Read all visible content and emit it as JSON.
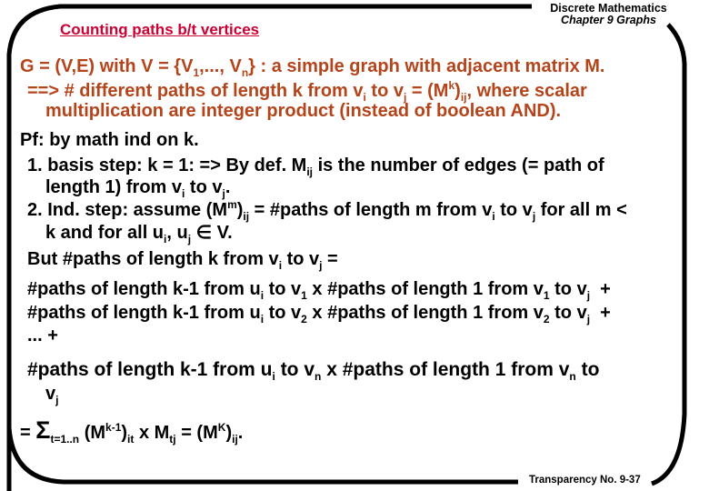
{
  "header": {
    "title": "Counting paths b/t vertices",
    "course": "Discrete Mathematics",
    "chapter": "Chapter 9 Graphs"
  },
  "colors": {
    "title": "#cc0033",
    "statement": "#b5441a",
    "body": "#000000",
    "frame": "#000000"
  },
  "body": {
    "l1": {
      "a": "G = (V,E) with V = {V",
      "s1": "1",
      "b": ",..., V",
      "s2": "n",
      "c": "} : a simple graph with adjacent matrix M."
    },
    "l2": {
      "a": "==> # different paths of length k from v",
      "s1": "i",
      "b": " to v",
      "s2": "j",
      "c": " = (M",
      "p1": "k",
      "d": ")",
      "s3": "ij",
      "e": ", where scalar"
    },
    "l3": "multiplication are integer product (instead of boolean AND).",
    "l4": "Pf: by math ind on k.",
    "l5": {
      "a": "1. basis step: k = 1: => By def. M",
      "s1": "ij",
      "b": " is the number of edges (= path of"
    },
    "l6": {
      "a": "length 1) from v",
      "s1": "i",
      "b": " to v",
      "s2": "j",
      "c": "."
    },
    "l7": {
      "a": "2. Ind. step: assume (M",
      "p1": "m",
      "b": ")",
      "s1": "ij",
      "c": " = #paths of length m from v",
      "s2": "i",
      "d": " to v",
      "s3": "j",
      "e": " for all m <"
    },
    "l8": {
      "a": "k and for all u",
      "s1": "i",
      "b": ", u",
      "s2": "j",
      "c": " ∈ V."
    },
    "l9": {
      "a": "But #paths of length k from v",
      "s1": "i",
      "b": " to v",
      "s2": "j",
      "c": " ="
    },
    "l10": {
      "a": "#paths of length k-1 from u",
      "s1": "i",
      "b": " to v",
      "s2": "1",
      "c": " x #paths of length 1 from v",
      "s3": "1",
      "d": " to v",
      "s4": "j",
      "e": "  +"
    },
    "l11": {
      "a": "#paths of length k-1 from u",
      "s1": "i",
      "b": " to v",
      "s2": "2",
      "c": " x #paths of length 1 from v",
      "s3": "2",
      "d": " to v",
      "s4": "j",
      "e": "  +"
    },
    "l12": "... +",
    "l13": {
      "a": "#paths of length k-1 from u",
      "s1": "i",
      "b": " to v",
      "s2": "n",
      "c": " x #paths of length 1 from v",
      "s3": "n",
      "d": " to"
    },
    "l14": {
      "a": "v",
      "s1": "j"
    },
    "l15": {
      "a": "= ",
      "sigma": "Σ",
      "s1": "t=1..n",
      "b": " (M",
      "p1": "k-1",
      "c": ")",
      "s2": "it",
      "d": " x M",
      "s3": "tj",
      "e": " = (M",
      "p2": "K",
      "f": ")",
      "s4": "ij",
      "g": "."
    }
  },
  "footer": {
    "label": "Transparency No. 9-37"
  }
}
